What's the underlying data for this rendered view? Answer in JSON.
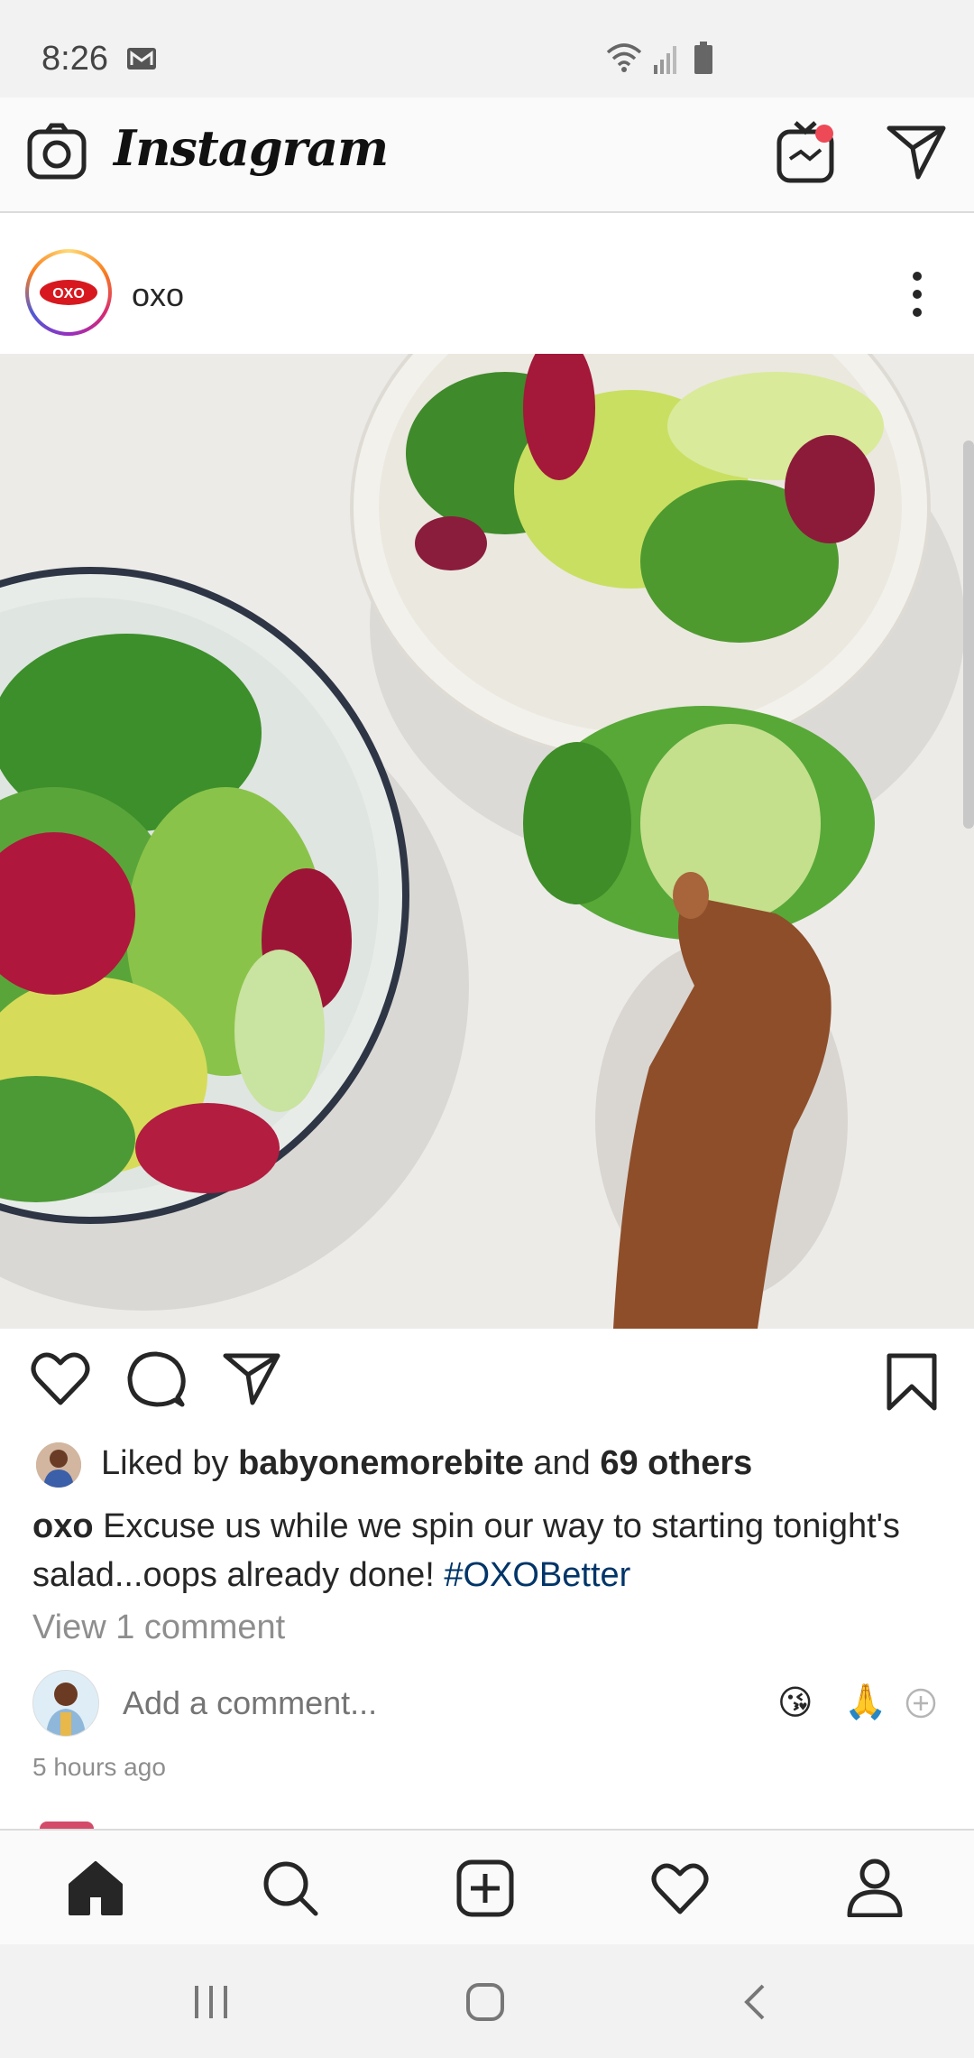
{
  "status_bar": {
    "time": "8:26",
    "icons": [
      "mail-icon",
      "wifi-icon",
      "signal-icon",
      "battery-icon"
    ]
  },
  "header": {
    "app_name": "Instagram",
    "icons": [
      "camera-icon",
      "igtv-icon",
      "direct-icon"
    ],
    "notification_color": "#ed4956"
  },
  "post": {
    "username": "oxo",
    "avatar_logo_text": "OXO",
    "likes": {
      "prefix": "Liked by ",
      "user": "babyonemorebite",
      "middle": " and ",
      "others": "69 others"
    },
    "caption": {
      "user": "oxo",
      "text": " Excuse us while we spin our way to starting tonight's salad...oops already done! ",
      "hashtag": "#OXOBetter"
    },
    "view_comments": "View 1 comment",
    "comment_placeholder": "Add a comment...",
    "quick_emojis": [
      "😘",
      "🙏"
    ],
    "timestamp": "5 hours ago"
  },
  "bottom_nav": {
    "items": [
      "home",
      "search",
      "add",
      "activity",
      "profile"
    ]
  },
  "colors": {
    "hashtag": "#003569",
    "muted": "#8e8e8e",
    "text": "#262626"
  }
}
